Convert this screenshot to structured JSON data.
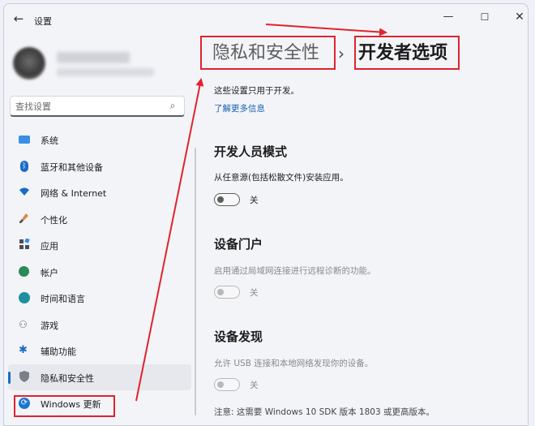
{
  "window": {
    "title": "设置",
    "back_icon": "←",
    "minimize_icon": "—",
    "maximize_icon": "☐",
    "close_icon": "✕"
  },
  "search": {
    "placeholder": "查找设置",
    "icon": "⌕"
  },
  "sidebar": {
    "items": [
      {
        "label": "系统",
        "icon": "monitor-icon"
      },
      {
        "label": "蓝牙和其他设备",
        "icon": "bluetooth-icon"
      },
      {
        "label": "网络 & Internet",
        "icon": "wifi-icon"
      },
      {
        "label": "个性化",
        "icon": "brush-icon"
      },
      {
        "label": "应用",
        "icon": "apps-icon"
      },
      {
        "label": "帐户",
        "icon": "user-icon"
      },
      {
        "label": "时间和语言",
        "icon": "globe-icon"
      },
      {
        "label": "游戏",
        "icon": "gamepad-icon"
      },
      {
        "label": "辅助功能",
        "icon": "accessibility-icon"
      },
      {
        "label": "隐私和安全性",
        "icon": "shield-icon",
        "active": true
      },
      {
        "label": "Windows 更新",
        "icon": "windows-update-icon"
      }
    ]
  },
  "breadcrumb": {
    "parent": "隐私和安全性",
    "separator": "›",
    "current": "开发者选项"
  },
  "intro": {
    "text": "这些设置只用于开发。",
    "learn_more": "了解更多信息"
  },
  "sections": [
    {
      "title": "开发人员模式",
      "description": "从任意源(包括松散文件)安装应用。",
      "toggle_label": "关",
      "enabled": true
    },
    {
      "title": "设备门户",
      "description": "启用通过局域网连接进行远程诊断的功能。",
      "toggle_label": "关",
      "enabled": false
    },
    {
      "title": "设备发现",
      "description": "允许 USB 连接和本地网络发现你的设备。",
      "toggle_label": "关",
      "enabled": false
    }
  ],
  "note": "注意: 这需要 Windows 10 SDK 版本 1803 或更高版本。",
  "colors": {
    "accent": "#1a6bc7",
    "annotation": "#e0232e"
  }
}
